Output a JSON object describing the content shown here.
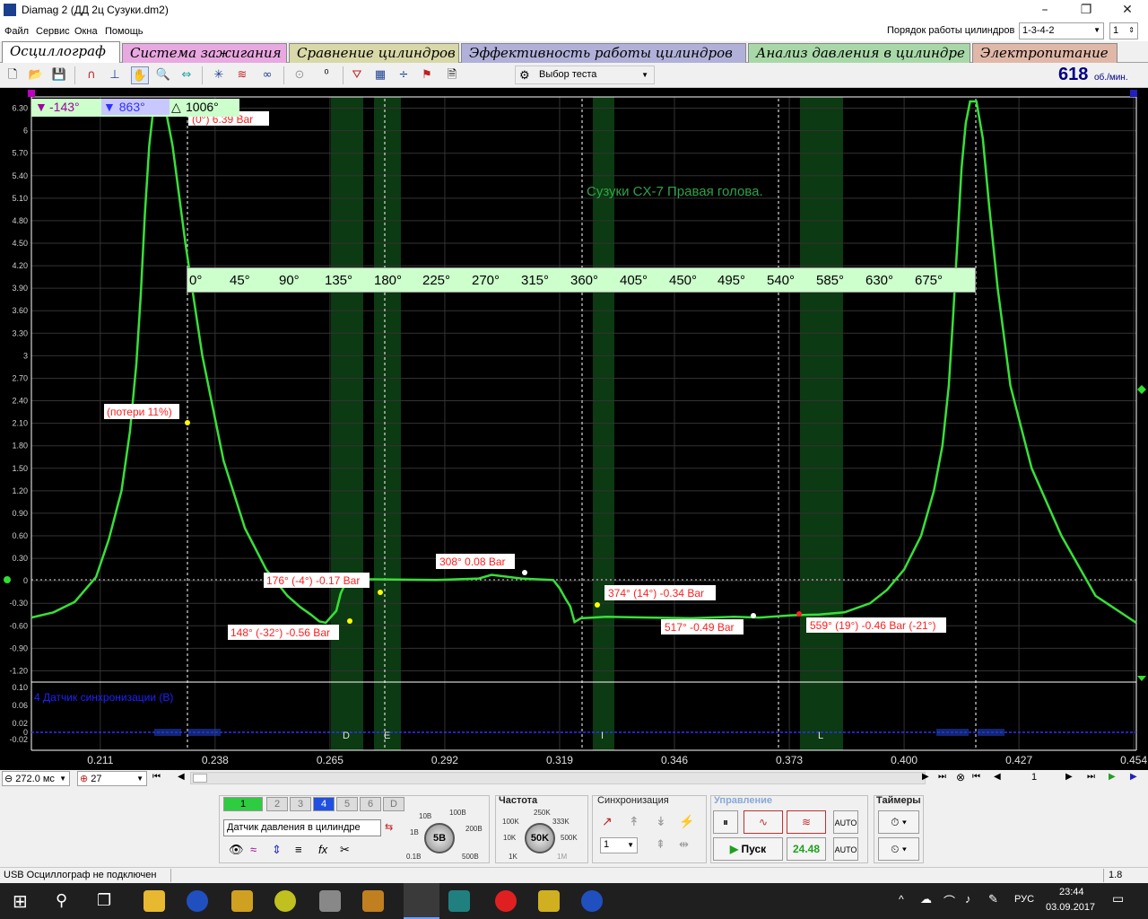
{
  "window": {
    "title": "Diamag 2 (ДД 2ц Сузуки.dm2)",
    "minimize": "–",
    "maximize": "❐",
    "close": "✕"
  },
  "menu": [
    "Файл",
    "Сервис",
    "Окна",
    "Помощь"
  ],
  "cylinder_order": {
    "label": "Порядок работы цилиндров",
    "value": "1-3-4-2",
    "cylinder": "1"
  },
  "tabs": [
    "Осциллограф",
    "Система зажигания",
    "Сравнение цилиндров",
    "Эффективность работы цилиндров",
    "Анализ давления в цилиндре",
    "Электропитание"
  ],
  "tab_colors": [
    "#ffffff",
    "#e8a8e0",
    "#d8d8a8",
    "#b0b0d8",
    "#a8d8a8",
    "#e0b8a8"
  ],
  "toolbar": {
    "test_select": "Выбор теста",
    "rpm": "618",
    "rpm_unit": "об./мин."
  },
  "cursor_box": {
    "a": "-143°",
    "b": "863°",
    "delta": "1006°"
  },
  "scope": {
    "title": "Сузуки CX-7 Правая голова.",
    "sync_label": "4 Датчик синхронизации (B)",
    "degree_scale": [
      "0°",
      "45°",
      "90°",
      "135°",
      "180°",
      "225°",
      "270°",
      "315°",
      "360°",
      "405°",
      "450°",
      "495°",
      "540°",
      "585°",
      "630°",
      "675°"
    ],
    "markers": {
      "peak": "(0°) 6.39 Bar",
      "loss": "(потери 11%)",
      "m176": "176° (-4°) -0.17 Bar",
      "m148": "148° (-32°) -0.56 Bar",
      "m308": "308° 0.08 Bar",
      "m374": "374° (14°) -0.34 Bar",
      "m517": "517° -0.49 Bar",
      "m559": "559° (19°) -0.46 Bar (-21°)"
    },
    "zones": [
      "D",
      "E",
      "I",
      "L"
    ],
    "sync_ticks": [
      "0.10",
      "0.06",
      "0.02",
      "0",
      "-0.02"
    ]
  },
  "chart_data": {
    "type": "line",
    "title": "Сузуки CX-7 Правая голова.",
    "xlabel": "",
    "ylabel": "",
    "x_ticks": [
      "0.211",
      "0.238",
      "0.265",
      "0.292",
      "0.319",
      "0.346",
      "0.373",
      "0.400",
      "0.427",
      "0.454"
    ],
    "y_ticks": [
      "6.30",
      "6",
      "5.70",
      "5.40",
      "5.10",
      "4.80",
      "4.50",
      "4.20",
      "3.90",
      "3.60",
      "3.30",
      "3",
      "2.70",
      "2.40",
      "2.10",
      "1.80",
      "1.50",
      "1.20",
      "0.90",
      "0.60",
      "0.30",
      "0",
      "-0.30",
      "-0.60",
      "-0.90",
      "-1.20"
    ],
    "ylim": [
      -1.35,
      6.45
    ],
    "xlim": [
      0.1948,
      0.4546
    ],
    "grid": true,
    "series": [
      {
        "x": [
          0.1948,
          0.2,
          0.205,
          0.21,
          0.213,
          0.216,
          0.218,
          0.2195,
          0.2205,
          0.2215,
          0.2225,
          0.2235,
          0.2245,
          0.226,
          0.228,
          0.231,
          0.235,
          0.24,
          0.245,
          0.25,
          0.255,
          0.258,
          0.2605,
          0.2625,
          0.264,
          0.2665,
          0.2675,
          0.2685,
          0.27,
          0.272,
          0.275,
          0.29,
          0.3,
          0.303,
          0.31,
          0.3175,
          0.319,
          0.3205,
          0.3215,
          0.3225,
          0.324,
          0.33,
          0.34,
          0.35,
          0.36,
          0.366,
          0.3735,
          0.38,
          0.386,
          0.392,
          0.396,
          0.4,
          0.404,
          0.407,
          0.409,
          0.4105,
          0.4115,
          0.4125,
          0.4135,
          0.4145,
          0.4155,
          0.417,
          0.4185,
          0.42,
          0.422,
          0.425,
          0.43,
          0.437,
          0.445,
          0.4546
        ],
        "y": [
          -0.49,
          -0.42,
          -0.28,
          0.05,
          0.55,
          1.2,
          2.0,
          2.9,
          3.8,
          4.9,
          5.8,
          6.3,
          6.39,
          6.39,
          5.8,
          4.5,
          3.0,
          1.6,
          0.7,
          0.15,
          -0.2,
          -0.35,
          -0.45,
          -0.54,
          -0.56,
          -0.4,
          -0.17,
          -0.05,
          0.0,
          0.02,
          0.02,
          0.01,
          0.03,
          0.08,
          0.03,
          0.01,
          -0.1,
          -0.25,
          -0.34,
          -0.55,
          -0.5,
          -0.48,
          -0.49,
          -0.5,
          -0.48,
          -0.49,
          -0.46,
          -0.45,
          -0.42,
          -0.3,
          -0.12,
          0.15,
          0.6,
          1.2,
          1.8,
          2.6,
          3.5,
          4.5,
          5.5,
          6.1,
          6.39,
          6.39,
          5.9,
          5.0,
          3.9,
          2.6,
          1.5,
          0.6,
          -0.2,
          -0.56
        ]
      }
    ]
  },
  "bottom_bar": {
    "time_value": "272.0 мс",
    "zoom_value": "27",
    "page": "1"
  },
  "channels": {
    "buttons": [
      "1",
      "2",
      "3",
      "4",
      "5",
      "6",
      "D"
    ],
    "sensor": "Датчик давления в цилиндре",
    "scale_labels": [
      "10В",
      "100В",
      "1В",
      "200В",
      "0.1В",
      "500В"
    ],
    "scale_value": "5В"
  },
  "frequency": {
    "label": "Частота",
    "value": "50K",
    "labels": [
      "250K",
      "100K",
      "333K",
      "10K",
      "500K",
      "1K",
      "1M"
    ]
  },
  "sync": {
    "label": "Синхронизация",
    "value": "1"
  },
  "control": {
    "label": "Управление",
    "start": "Пуск",
    "value": "24.48"
  },
  "timers": {
    "label": "Таймеры"
  },
  "status": {
    "left": "USB Осциллограф не подключен",
    "right": "1.8"
  },
  "taskbar": {
    "lang": "РУС",
    "time": "23:44",
    "date": "03.09.2017"
  }
}
